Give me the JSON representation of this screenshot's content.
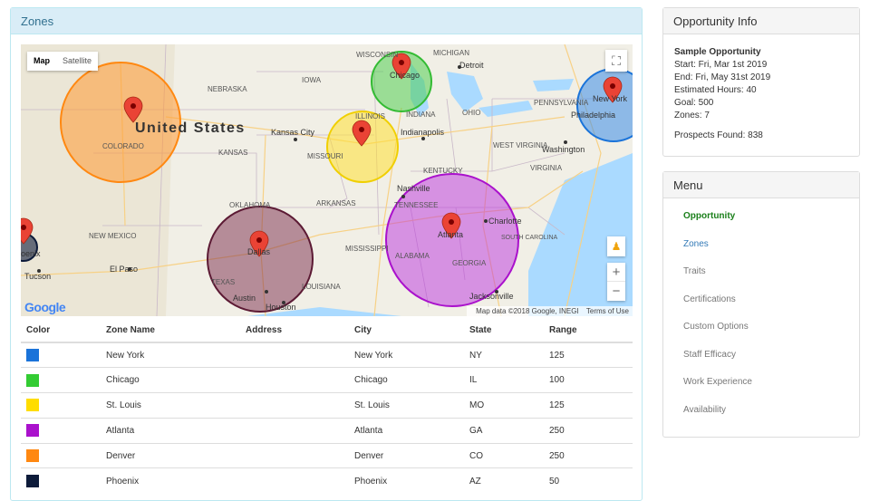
{
  "zones_panel": {
    "title": "Zones"
  },
  "map": {
    "type_map": "Map",
    "type_satellite": "Satellite",
    "fullscreen_icon": "fullscreen-icon",
    "zoom_in": "+",
    "zoom_out": "−",
    "google": "Google",
    "credit_data": "Map data ©2018 Google, INEGI",
    "credit_terms": "Terms of Use",
    "labels": {
      "united_states": "United States",
      "nebraska": "NEBRASKA",
      "iowa": "IOWA",
      "colorado": "COLORADO",
      "kansas": "KANSAS",
      "missouri": "MISSOURI",
      "illinois": "ILLINOIS",
      "indiana": "INDIANA",
      "ohio": "OHIO",
      "kansas_city": "Kansas City",
      "indianapolis": "Indianapolis",
      "chicago": "Chicago",
      "detroit": "Detroit",
      "new_york": "New York",
      "pennsylvania": "PENNSYLVANIA",
      "philadelphia": "Philadelphia",
      "washington": "Washington",
      "west_virginia": "WEST VIRGINIA",
      "virginia": "VIRGINIA",
      "kentucky": "KENTUCKY",
      "nashville": "Nashville",
      "tennessee": "TENNESSEE",
      "charlotte": "Charlotte",
      "south_carolina": "SOUTH CAROLINA",
      "atlanta": "Atlanta",
      "alabama": "ALABAMA",
      "georgia": "GEORGIA",
      "jacksonville": "Jacksonville",
      "oklahoma": "OKLAHOMA",
      "arkansas": "ARKANSAS",
      "mississippi": "MISSISSIPPI",
      "new_mexico": "NEW MEXICO",
      "el_paso": "El Paso",
      "tucson": "Tucson",
      "phoenix": "oenix",
      "dallas": "Dallas",
      "texas": "TEXAS",
      "austin": "Austin",
      "houston": "Houston",
      "louisiana": "LOUISIANA",
      "wisconsin": "WISCONSIN",
      "michigan": "MICHIGAN"
    }
  },
  "table": {
    "headers": {
      "color": "Color",
      "zone_name": "Zone Name",
      "address": "Address",
      "city": "City",
      "state": "State",
      "range": "Range"
    },
    "rows": [
      {
        "color": "#1a73d9",
        "zone_name": "New York",
        "address": "",
        "city": "New York",
        "state": "NY",
        "range": "125"
      },
      {
        "color": "#33cc33",
        "zone_name": "Chicago",
        "address": "",
        "city": "Chicago",
        "state": "IL",
        "range": "100"
      },
      {
        "color": "#ffdd00",
        "zone_name": "St. Louis",
        "address": "",
        "city": "St. Louis",
        "state": "MO",
        "range": "125"
      },
      {
        "color": "#aa11cc",
        "zone_name": "Atlanta",
        "address": "",
        "city": "Atlanta",
        "state": "GA",
        "range": "250"
      },
      {
        "color": "#ff8811",
        "zone_name": "Denver",
        "address": "",
        "city": "Denver",
        "state": "CO",
        "range": "250"
      },
      {
        "color": "#0d1b3a",
        "zone_name": "Phoenix",
        "address": "",
        "city": "Phoenix",
        "state": "AZ",
        "range": "50"
      }
    ]
  },
  "info_panel": {
    "title": "Opportunity Info",
    "name": "Sample Opportunity",
    "start": "Start: Fri, Mar 1st 2019",
    "end": "End: Fri, May 31st 2019",
    "hours": "Estimated Hours: 40",
    "goal": "Goal: 500",
    "zones": "Zones: 7",
    "prospects": "Prospects Found: 838"
  },
  "menu_panel": {
    "title": "Menu",
    "items": [
      {
        "label": "Opportunity",
        "state": "active"
      },
      {
        "label": "Zones",
        "state": "link"
      },
      {
        "label": "Traits",
        "state": "normal"
      },
      {
        "label": "Certifications",
        "state": "normal"
      },
      {
        "label": "Custom Options",
        "state": "normal"
      },
      {
        "label": "Staff Efficacy",
        "state": "normal"
      },
      {
        "label": "Work Experience",
        "state": "normal"
      },
      {
        "label": "Availability",
        "state": "normal"
      }
    ]
  }
}
